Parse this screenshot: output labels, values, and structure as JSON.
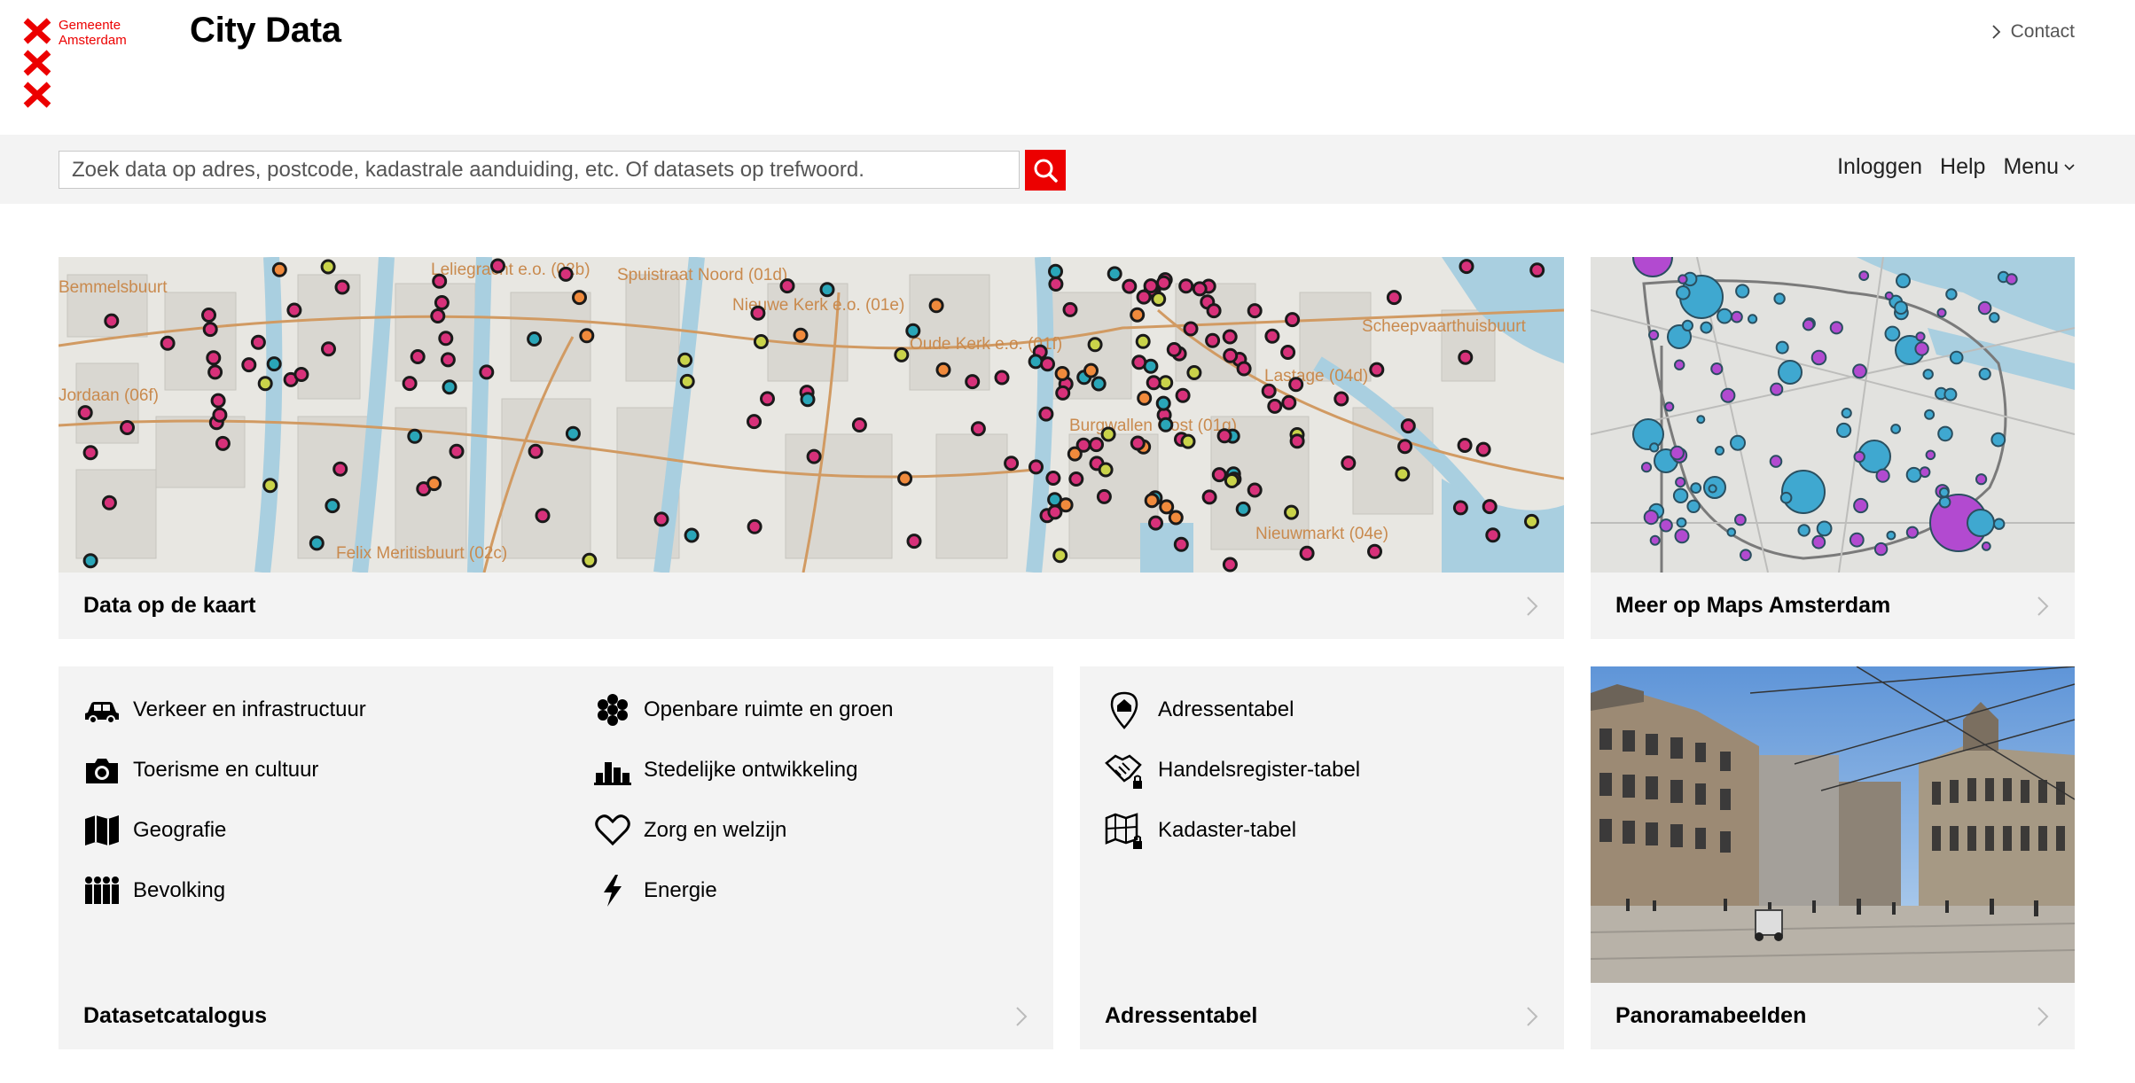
{
  "brand": {
    "logo_line1": "Gemeente",
    "logo_line2": "Amsterdam",
    "site_title": "City Data",
    "accent_color": "#ec0000"
  },
  "header": {
    "contact_label": "Contact"
  },
  "search": {
    "placeholder": "Zoek data op adres, postcode, kadastrale aanduiding, etc. Of datasets op trefwoord.",
    "button_icon": "search-icon"
  },
  "nav": {
    "login_label": "Inloggen",
    "help_label": "Help",
    "menu_label": "Menu"
  },
  "tiles": {
    "map_main": {
      "title": "Data op de kaart",
      "map_labels": [
        "Leliegracht e.o. (02b)",
        "Spuistraat Noord (01d)",
        "Nieuwe Kerk e.o. (01e)",
        "Oude Kerk e.o. (01f)",
        "Scheepvaarthuisbuurt",
        "Lastage (04d)",
        "Burgwallen Oost (01g)",
        "Nieuwmarkt (04e)",
        "Felix Meritisbuurt (02c)",
        "Jordaan (06f)",
        "Bemmelsbuurt"
      ]
    },
    "map_side": {
      "title": "Meer op Maps Amsterdam"
    },
    "catalog": {
      "title": "Datasetcatalogus",
      "themes": [
        {
          "label": "Verkeer en infrastructuur",
          "icon": "car-icon"
        },
        {
          "label": "Openbare ruimte en groen",
          "icon": "flower-icon"
        },
        {
          "label": "Toerisme en cultuur",
          "icon": "camera-icon"
        },
        {
          "label": "Stedelijke ontwikkeling",
          "icon": "buildings-icon"
        },
        {
          "label": "Geografie",
          "icon": "map-icon"
        },
        {
          "label": "Zorg en welzijn",
          "icon": "heart-icon"
        },
        {
          "label": "Bevolking",
          "icon": "people-icon"
        },
        {
          "label": "Energie",
          "icon": "lightning-icon"
        }
      ]
    },
    "adressentabel": {
      "title": "Adressentabel",
      "items": [
        {
          "label": "Adressentabel",
          "icon": "location-home-icon"
        },
        {
          "label": "Handelsregister-tabel",
          "icon": "handshake-lock-icon"
        },
        {
          "label": "Kadaster-tabel",
          "icon": "map-lock-icon"
        }
      ]
    },
    "panorama": {
      "title": "Panoramabeelden"
    }
  }
}
